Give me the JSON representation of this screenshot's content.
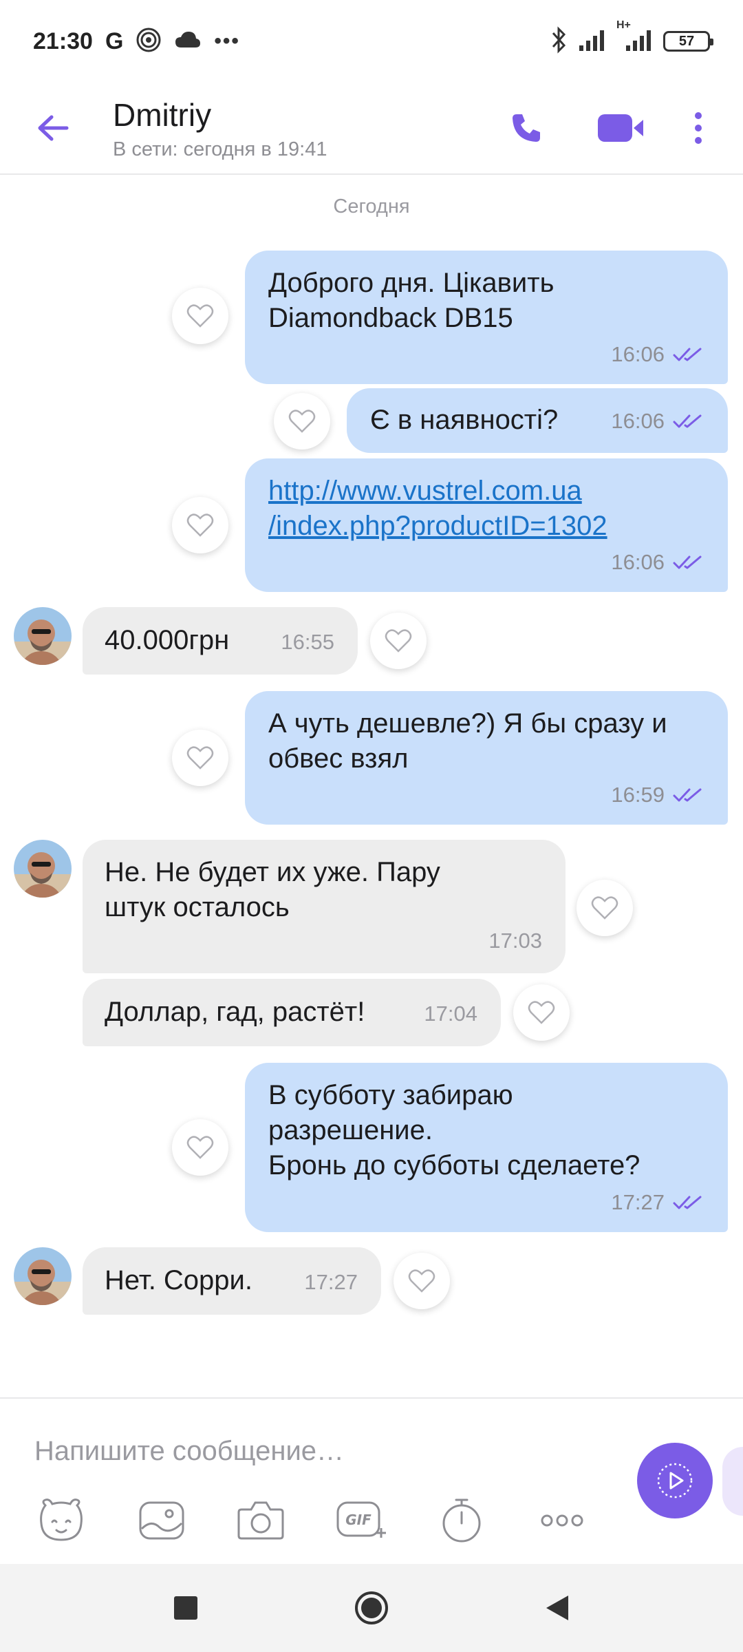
{
  "status_bar": {
    "time": "21:30",
    "g_label": "G",
    "more": "•••",
    "network": "H+",
    "battery": "57"
  },
  "header": {
    "name": "Dmitriy",
    "status": "В сети: сегодня в 19:41",
    "icons": [
      "back-arrow-icon",
      "phone-icon",
      "video-icon",
      "more-vert-icon"
    ],
    "accent": "#7b5ce6"
  },
  "chat": {
    "date_separator": "Сегодня",
    "messages": [
      {
        "dir": "out",
        "text": "Доброго дня. Цікавить\nDiamondback DB15",
        "time": "16:06"
      },
      {
        "dir": "out",
        "text": "Є в наявності?",
        "time": "16:06"
      },
      {
        "dir": "out",
        "text": "http://www.vustrel.com.ua\n/index.php?productID=1302",
        "time": "16:06",
        "is_link": true
      },
      {
        "dir": "in",
        "text": "40.000грн",
        "time": "16:55"
      },
      {
        "dir": "out",
        "text": "А чуть дешевле?) Я бы сразу и\nобвес взял",
        "time": "16:59"
      },
      {
        "dir": "in",
        "text": "Не. Не будет их уже. Пару\nштук осталось",
        "time": "17:03"
      },
      {
        "dir": "in",
        "text": "Доллар, гад, растёт!",
        "time": "17:04"
      },
      {
        "dir": "out",
        "text": "В субботу забираю\nразрешение.\nБронь до субботы сделаете?",
        "time": "17:27"
      },
      {
        "dir": "in",
        "text": "Нет. Сорри.",
        "time": "17:27"
      }
    ],
    "outgoing_color": "#c9dffb",
    "incoming_color": "#ededed"
  },
  "composer": {
    "placeholder": "Напишите сообщение…",
    "tools": [
      "sticker-icon",
      "gallery-icon",
      "camera-icon",
      "gif-icon",
      "timer-icon",
      "more-horiz-icon"
    ],
    "gif_label": "GIF"
  },
  "navbar": {
    "buttons": [
      "recent-apps-icon",
      "home-icon",
      "back-icon"
    ]
  }
}
